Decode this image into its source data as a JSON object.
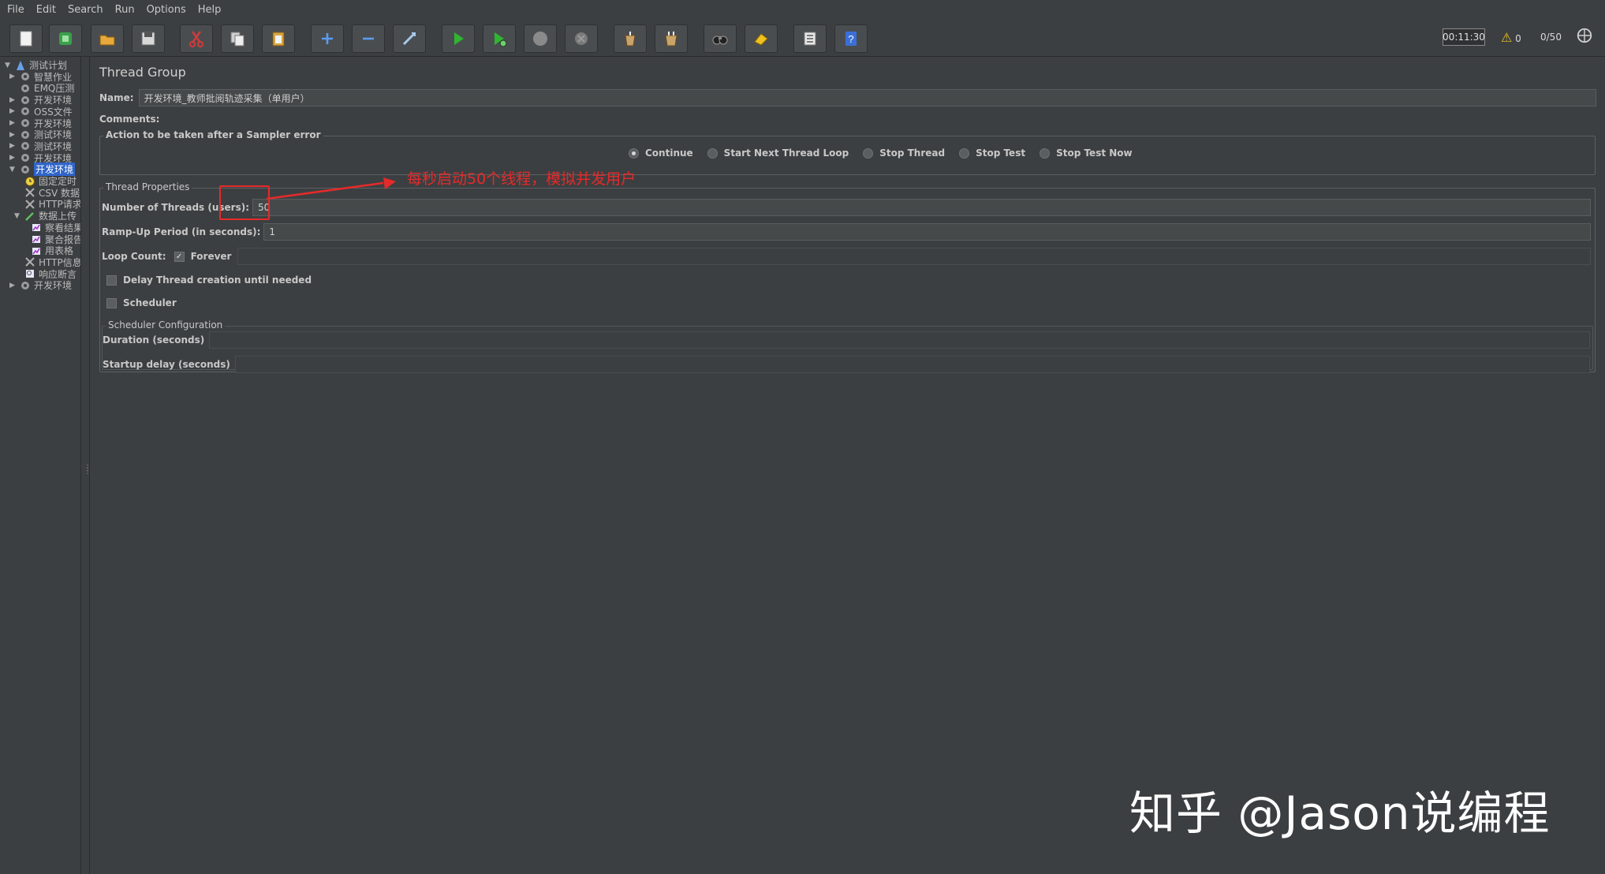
{
  "menu": [
    "File",
    "Edit",
    "Search",
    "Run",
    "Options",
    "Help"
  ],
  "toolbar": {
    "buttons": [
      {
        "name": "new-icon"
      },
      {
        "name": "templates-icon"
      },
      {
        "name": "open-icon"
      },
      {
        "name": "save-icon"
      },
      {
        "name": "cut-icon"
      },
      {
        "name": "copy-icon"
      },
      {
        "name": "paste-icon"
      },
      {
        "name": "expand-icon"
      },
      {
        "name": "collapse-icon"
      },
      {
        "name": "toggle-icon"
      },
      {
        "name": "start-icon"
      },
      {
        "name": "start-no-timers-icon"
      },
      {
        "name": "stop-icon"
      },
      {
        "name": "shutdown-icon"
      },
      {
        "name": "clear-icon"
      },
      {
        "name": "clear-all-icon"
      },
      {
        "name": "search-icon"
      },
      {
        "name": "reset-search-icon"
      },
      {
        "name": "function-helper-icon"
      },
      {
        "name": "help-icon"
      }
    ],
    "timer": "00:11:30",
    "warning_count": "0",
    "threads": "0/50",
    "icon_colors": {
      "start": "#2fb52f",
      "cut": "#d23a3a",
      "help": "#3b6fd8",
      "warning": "#f0c020"
    }
  },
  "tree": {
    "items": [
      {
        "label": "测试计划",
        "level": 0,
        "arrow": "▼",
        "icon": "plan-icon"
      },
      {
        "label": "智慧作业",
        "level": 1,
        "arrow": "▶",
        "icon": "gear-icon"
      },
      {
        "label": "EMQ压测",
        "level": 1,
        "arrow": "",
        "icon": "gear-icon"
      },
      {
        "label": "开发环境",
        "level": 1,
        "arrow": "▶",
        "icon": "gear-icon"
      },
      {
        "label": "OSS文件",
        "level": 1,
        "arrow": "▶",
        "icon": "gear-icon"
      },
      {
        "label": "开发环境",
        "level": 1,
        "arrow": "▶",
        "icon": "gear-icon"
      },
      {
        "label": "测试环境",
        "level": 1,
        "arrow": "▶",
        "icon": "gear-icon"
      },
      {
        "label": "测试环境",
        "level": 1,
        "arrow": "▶",
        "icon": "gear-icon"
      },
      {
        "label": "开发环境",
        "level": 1,
        "arrow": "▶",
        "icon": "gear-icon"
      },
      {
        "label": "开发环境",
        "level": 1,
        "arrow": "▼",
        "icon": "gear-icon",
        "selected": true
      },
      {
        "label": "固定定时",
        "level": 2,
        "arrow": "",
        "icon": "timer-icon"
      },
      {
        "label": "CSV 数据",
        "level": 2,
        "arrow": "",
        "icon": "wrench-icon"
      },
      {
        "label": "HTTP请求",
        "level": 2,
        "arrow": "",
        "icon": "wrench-icon"
      },
      {
        "label": "数据上传",
        "level": 2,
        "arrow": "▼",
        "icon": "pipette-icon"
      },
      {
        "label": "察看结果",
        "level": 3,
        "arrow": "",
        "icon": "listener-icon"
      },
      {
        "label": "聚合报告",
        "level": 3,
        "arrow": "",
        "icon": "listener-icon"
      },
      {
        "label": "用表格",
        "level": 3,
        "arrow": "",
        "icon": "listener-icon"
      },
      {
        "label": "HTTP信息",
        "level": 2,
        "arrow": "",
        "icon": "wrench-icon"
      },
      {
        "label": "响应断言",
        "level": 2,
        "arrow": "",
        "icon": "assertion-icon"
      },
      {
        "label": "开发环境",
        "level": 1,
        "arrow": "▶",
        "icon": "gear-icon"
      }
    ]
  },
  "panel": {
    "title": "Thread Group",
    "name_label": "Name:",
    "name_value": "开发环境_教师批阅轨迹采集（单用户）",
    "comments_label": "Comments:",
    "sampler_error": {
      "legend": "Action to be taken after a Sampler error",
      "options": [
        {
          "label": "Continue",
          "selected": true
        },
        {
          "label": "Start Next Thread Loop",
          "selected": false
        },
        {
          "label": "Stop Thread",
          "selected": false
        },
        {
          "label": "Stop Test",
          "selected": false
        },
        {
          "label": "Stop Test Now",
          "selected": false
        }
      ]
    },
    "thread_props": {
      "legend": "Thread Properties",
      "num_threads_label": "Number of Threads (users):",
      "num_threads_value": "50",
      "rampup_label": "Ramp-Up Period (in seconds):",
      "rampup_value": "1",
      "loop_label": "Loop Count:",
      "forever_label": "Forever",
      "forever_checked": true,
      "delay_label": "Delay Thread creation until needed",
      "delay_checked": false,
      "scheduler_label": "Scheduler",
      "scheduler_checked": false
    },
    "scheduler_config": {
      "legend": "Scheduler Configuration",
      "duration_label": "Duration (seconds)",
      "startup_label": "Startup delay (seconds)"
    }
  },
  "annotation": {
    "text": "每秒启动50个线程，模拟并发用户",
    "color": "#e52a2a"
  },
  "watermark": "知乎 @Jason说编程"
}
